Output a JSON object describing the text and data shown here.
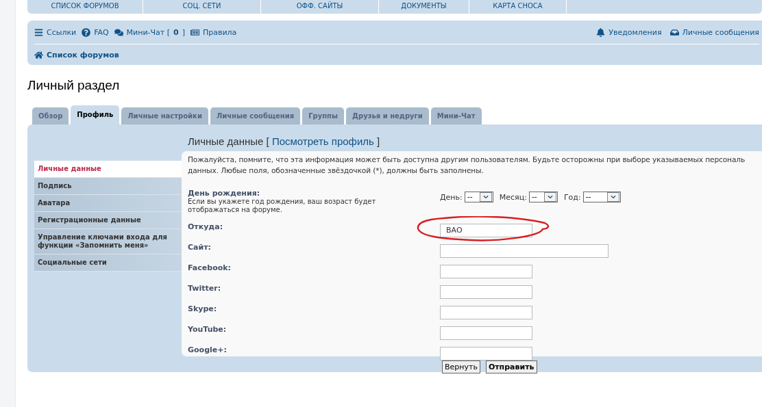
{
  "top_nav": [
    "СПИСОК ФОРУМОВ",
    "СОЦ. СЕТИ",
    "ОФФ. САЙТЫ",
    "ДОКУМЕНТЫ",
    "КАРТА СНОСА"
  ],
  "quick_links": [
    {
      "label": "Ссылки"
    },
    {
      "label": "FAQ"
    },
    {
      "label": "Мини-Чат [",
      "count": "0",
      "suffix": "]"
    },
    {
      "label": "Правила"
    }
  ],
  "user_links": [
    {
      "label": "Уведомления"
    },
    {
      "label": "Личные сообщения"
    }
  ],
  "breadcrumb": "Список форумов",
  "page_title": "Личный раздел",
  "tabs": [
    {
      "label": "Обзор",
      "selected": false
    },
    {
      "label": "Профиль",
      "selected": true
    },
    {
      "label": "Личные настройки",
      "selected": false
    },
    {
      "label": "Личные сообщения",
      "selected": false
    },
    {
      "label": "Группы",
      "selected": false
    },
    {
      "label": "Друзья и недруги",
      "selected": false
    },
    {
      "label": "Мини-Чат",
      "selected": false
    }
  ],
  "sidebar": {
    "items": [
      {
        "label": "Личные данные",
        "selected": true
      },
      {
        "label": "Подпись",
        "selected": false
      },
      {
        "label": "Аватара",
        "selected": false
      },
      {
        "label": "Регистрационные данные",
        "selected": false
      },
      {
        "label": "Управление ключами входа для функции «Запомнить меня»",
        "selected": false
      },
      {
        "label": "Социальные сети",
        "selected": false
      }
    ]
  },
  "section": {
    "title": "Личные данные",
    "link_open": "[",
    "link": "Посмотреть профиль",
    "link_close": "]"
  },
  "intro_lines": [
    "Пожалуйста, помните, что эта информация может быть доступна другим пользователям. Будьте осторожны при выборе указываемых персональ",
    "данных. Любые поля, обозначенные звёздочкой (*), должны быть заполнены."
  ],
  "birthday": {
    "label": "День рождения:",
    "hint": "Если вы укажете год рождения, ваш возраст будет отображаться на форуме.",
    "selects": [
      {
        "label": "День:",
        "value": "--"
      },
      {
        "label": "Месяц:",
        "value": "--"
      },
      {
        "label": "Год:",
        "value": "--"
      }
    ]
  },
  "fields": [
    {
      "label": "Откуда:",
      "value": "ВАО",
      "wide": false,
      "highlighted": true
    },
    {
      "label": "Сайт:",
      "wide": true,
      "highlighted": false
    },
    {
      "label": "Facebook:",
      "wide": false,
      "highlighted": false
    },
    {
      "label": "Twitter:",
      "wide": false,
      "highlighted": false
    },
    {
      "label": "Skype:",
      "wide": false,
      "highlighted": false
    },
    {
      "label": "YouTube:",
      "wide": false,
      "highlighted": false
    },
    {
      "label": "Google+:",
      "wide": false,
      "highlighted": false
    }
  ],
  "buttons": [
    {
      "label": "Вернуть",
      "primary": false
    },
    {
      "label": "Отправить",
      "primary": true
    }
  ]
}
